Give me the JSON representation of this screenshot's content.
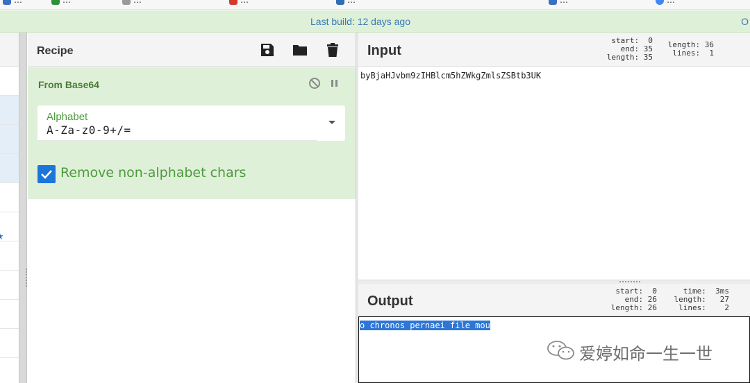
{
  "bookmarks": [
    {
      "label": "…",
      "color": "#3a6fc4"
    },
    {
      "label": "…",
      "color": "#2f8f3a"
    },
    {
      "label": "…",
      "color": "#9a9a9a"
    },
    {
      "label": "…",
      "color": "#d33a2c"
    },
    {
      "label": "…",
      "color": "#2f6db5"
    },
    {
      "label": "…",
      "color": "#3a6fc4"
    },
    {
      "label": "…",
      "color": "#4285f4"
    }
  ],
  "banner": {
    "message": "Last build: 12 days ago",
    "close": "O"
  },
  "recipe": {
    "title": "Recipe",
    "operation": {
      "name": "From Base64",
      "alphabet_label": "Alphabet",
      "alphabet_value": "A-Za-z0-9+/=",
      "remove_label": "Remove non-alphabet chars",
      "remove_checked": true
    }
  },
  "input": {
    "title": "Input",
    "stats_left": "start:  0\nend: 35\nlength: 35",
    "stats_right": "length: 36\nlines:  1",
    "text": "byBjaHJvbm9zIHBlcm5hZWkgZmlsZSBtb3UK"
  },
  "output": {
    "title": "Output",
    "stats_left": "start:  0\nend: 26\nlength: 26",
    "stats_right": "time:  3ms\nlength:   27\nlines:    2",
    "text": "o chronos pernaei file mou"
  },
  "watermark": {
    "text": "爱婷如命一生一世"
  },
  "colors": {
    "accent": "#1c75d8",
    "op_bg": "#dff0d8",
    "op_text": "#4d9a3e",
    "banner_text": "#3b79b7",
    "selection": "#2b76d6"
  }
}
